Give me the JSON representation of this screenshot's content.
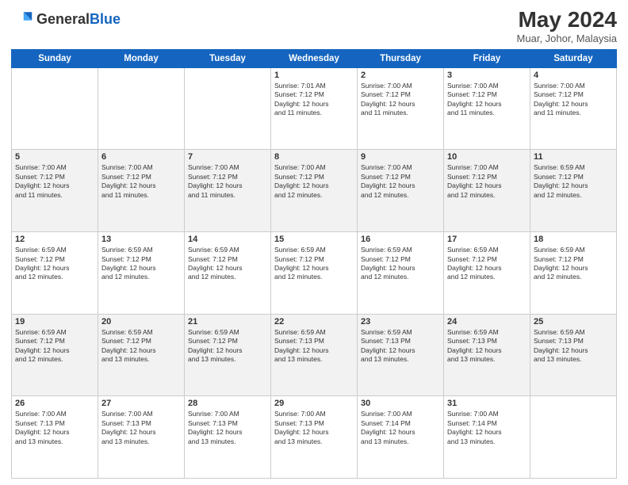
{
  "header": {
    "logo_general": "General",
    "logo_blue": "Blue",
    "month_year": "May 2024",
    "location": "Muar, Johor, Malaysia"
  },
  "weekdays": [
    "Sunday",
    "Monday",
    "Tuesday",
    "Wednesday",
    "Thursday",
    "Friday",
    "Saturday"
  ],
  "rows": [
    {
      "cells": [
        {
          "day": "",
          "info": ""
        },
        {
          "day": "",
          "info": ""
        },
        {
          "day": "",
          "info": ""
        },
        {
          "day": "1",
          "info": "Sunrise: 7:01 AM\nSunset: 7:12 PM\nDaylight: 12 hours\nand 11 minutes."
        },
        {
          "day": "2",
          "info": "Sunrise: 7:00 AM\nSunset: 7:12 PM\nDaylight: 12 hours\nand 11 minutes."
        },
        {
          "day": "3",
          "info": "Sunrise: 7:00 AM\nSunset: 7:12 PM\nDaylight: 12 hours\nand 11 minutes."
        },
        {
          "day": "4",
          "info": "Sunrise: 7:00 AM\nSunset: 7:12 PM\nDaylight: 12 hours\nand 11 minutes."
        }
      ]
    },
    {
      "cells": [
        {
          "day": "5",
          "info": "Sunrise: 7:00 AM\nSunset: 7:12 PM\nDaylight: 12 hours\nand 11 minutes."
        },
        {
          "day": "6",
          "info": "Sunrise: 7:00 AM\nSunset: 7:12 PM\nDaylight: 12 hours\nand 11 minutes."
        },
        {
          "day": "7",
          "info": "Sunrise: 7:00 AM\nSunset: 7:12 PM\nDaylight: 12 hours\nand 11 minutes."
        },
        {
          "day": "8",
          "info": "Sunrise: 7:00 AM\nSunset: 7:12 PM\nDaylight: 12 hours\nand 12 minutes."
        },
        {
          "day": "9",
          "info": "Sunrise: 7:00 AM\nSunset: 7:12 PM\nDaylight: 12 hours\nand 12 minutes."
        },
        {
          "day": "10",
          "info": "Sunrise: 7:00 AM\nSunset: 7:12 PM\nDaylight: 12 hours\nand 12 minutes."
        },
        {
          "day": "11",
          "info": "Sunrise: 6:59 AM\nSunset: 7:12 PM\nDaylight: 12 hours\nand 12 minutes."
        }
      ]
    },
    {
      "cells": [
        {
          "day": "12",
          "info": "Sunrise: 6:59 AM\nSunset: 7:12 PM\nDaylight: 12 hours\nand 12 minutes."
        },
        {
          "day": "13",
          "info": "Sunrise: 6:59 AM\nSunset: 7:12 PM\nDaylight: 12 hours\nand 12 minutes."
        },
        {
          "day": "14",
          "info": "Sunrise: 6:59 AM\nSunset: 7:12 PM\nDaylight: 12 hours\nand 12 minutes."
        },
        {
          "day": "15",
          "info": "Sunrise: 6:59 AM\nSunset: 7:12 PM\nDaylight: 12 hours\nand 12 minutes."
        },
        {
          "day": "16",
          "info": "Sunrise: 6:59 AM\nSunset: 7:12 PM\nDaylight: 12 hours\nand 12 minutes."
        },
        {
          "day": "17",
          "info": "Sunrise: 6:59 AM\nSunset: 7:12 PM\nDaylight: 12 hours\nand 12 minutes."
        },
        {
          "day": "18",
          "info": "Sunrise: 6:59 AM\nSunset: 7:12 PM\nDaylight: 12 hours\nand 12 minutes."
        }
      ]
    },
    {
      "cells": [
        {
          "day": "19",
          "info": "Sunrise: 6:59 AM\nSunset: 7:12 PM\nDaylight: 12 hours\nand 12 minutes."
        },
        {
          "day": "20",
          "info": "Sunrise: 6:59 AM\nSunset: 7:12 PM\nDaylight: 12 hours\nand 13 minutes."
        },
        {
          "day": "21",
          "info": "Sunrise: 6:59 AM\nSunset: 7:12 PM\nDaylight: 12 hours\nand 13 minutes."
        },
        {
          "day": "22",
          "info": "Sunrise: 6:59 AM\nSunset: 7:13 PM\nDaylight: 12 hours\nand 13 minutes."
        },
        {
          "day": "23",
          "info": "Sunrise: 6:59 AM\nSunset: 7:13 PM\nDaylight: 12 hours\nand 13 minutes."
        },
        {
          "day": "24",
          "info": "Sunrise: 6:59 AM\nSunset: 7:13 PM\nDaylight: 12 hours\nand 13 minutes."
        },
        {
          "day": "25",
          "info": "Sunrise: 6:59 AM\nSunset: 7:13 PM\nDaylight: 12 hours\nand 13 minutes."
        }
      ]
    },
    {
      "cells": [
        {
          "day": "26",
          "info": "Sunrise: 7:00 AM\nSunset: 7:13 PM\nDaylight: 12 hours\nand 13 minutes."
        },
        {
          "day": "27",
          "info": "Sunrise: 7:00 AM\nSunset: 7:13 PM\nDaylight: 12 hours\nand 13 minutes."
        },
        {
          "day": "28",
          "info": "Sunrise: 7:00 AM\nSunset: 7:13 PM\nDaylight: 12 hours\nand 13 minutes."
        },
        {
          "day": "29",
          "info": "Sunrise: 7:00 AM\nSunset: 7:13 PM\nDaylight: 12 hours\nand 13 minutes."
        },
        {
          "day": "30",
          "info": "Sunrise: 7:00 AM\nSunset: 7:14 PM\nDaylight: 12 hours\nand 13 minutes."
        },
        {
          "day": "31",
          "info": "Sunrise: 7:00 AM\nSunset: 7:14 PM\nDaylight: 12 hours\nand 13 minutes."
        },
        {
          "day": "",
          "info": ""
        }
      ]
    }
  ]
}
